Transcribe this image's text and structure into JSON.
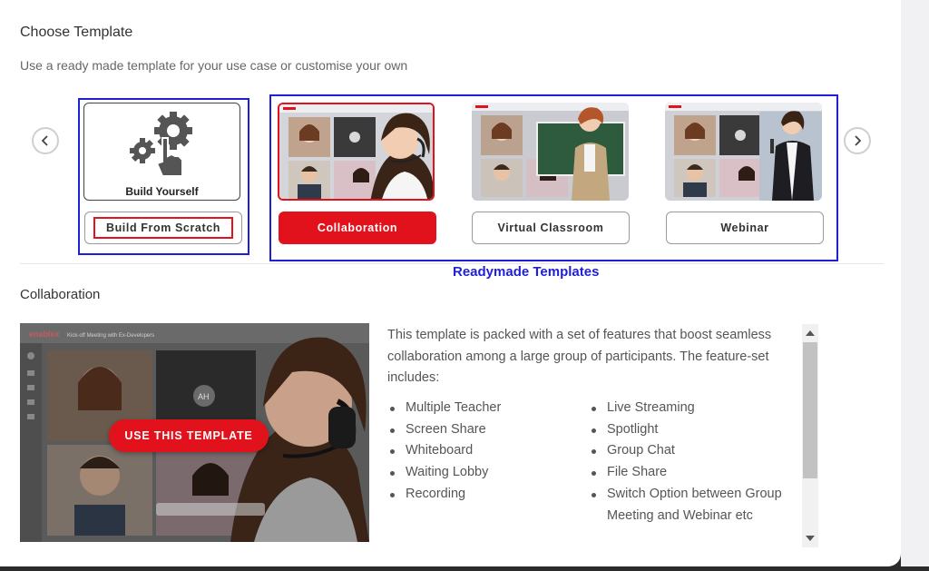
{
  "header": {
    "title": "Choose Template",
    "subtitle": "Use a ready made template for your use case or customise your own"
  },
  "carousel": {
    "prev_icon": "chevron-left-icon",
    "next_icon": "chevron-right-icon",
    "build_card": {
      "thumb_label": "Build Yourself",
      "button_label": "Build From Scratch"
    },
    "templates": [
      {
        "label": "Collaboration",
        "selected": true
      },
      {
        "label": "Virtual Classroom",
        "selected": false
      },
      {
        "label": "Webinar",
        "selected": false
      }
    ],
    "annotation": "Readymade Templates"
  },
  "detail": {
    "title": "Collaboration",
    "use_button": "USE THIS TEMPLATE",
    "brand": "enablex",
    "meeting_title": "Kick-off Meeting with Ex-Developers",
    "avatar_initials": "AH",
    "description": "This template is packed with a set of features that boost seamless collaboration among a large group of participants. The feature-set includes:",
    "features_left": [
      "Multiple Teacher",
      "Screen Share",
      "Whiteboard",
      "Waiting Lobby",
      "Recording"
    ],
    "features_right": [
      "Live Streaming",
      "Spotlight",
      "Group Chat",
      "File Share",
      "Switch Option between Group Meeting and Webinar etc"
    ]
  },
  "colors": {
    "accent": "#e1121b",
    "annotation": "#1f1fd6"
  }
}
